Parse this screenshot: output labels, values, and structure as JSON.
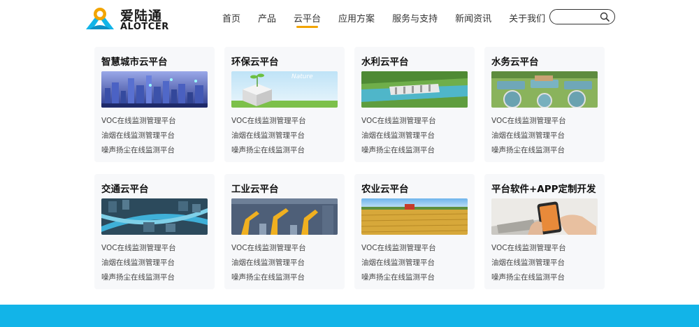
{
  "brand": {
    "name_cn": "爱陆通",
    "name_en": "ALOTCER"
  },
  "nav": [
    "首页",
    "产品",
    "云平台",
    "应用方案",
    "服务与支持",
    "新闻资讯",
    "关于我们"
  ],
  "nav_active": 2,
  "search": {
    "placeholder": ""
  },
  "colors": {
    "accent": "#f2a400",
    "footer": "#12b4e8",
    "card_bg": "#f7f8fa"
  },
  "cards": [
    {
      "title": "智慧城市云平台",
      "links": [
        "VOC在线监测管理平台",
        "油烟在线监测管理平台",
        "噪声扬尘在线监测平台"
      ],
      "img_label": ""
    },
    {
      "title": "环保云平台",
      "links": [
        "VOC在线监测管理平台",
        "油烟在线监测管理平台",
        "噪声扬尘在线监测平台"
      ],
      "img_label": "Nature"
    },
    {
      "title": "水利云平台",
      "links": [
        "VOC在线监测管理平台",
        "油烟在线监测管理平台",
        "噪声扬尘在线监测平台"
      ],
      "img_label": ""
    },
    {
      "title": "水务云平台",
      "links": [
        "VOC在线监测管理平台",
        "油烟在线监测管理平台",
        "噪声扬尘在线监测平台"
      ],
      "img_label": ""
    },
    {
      "title": "交通云平台",
      "links": [
        "VOC在线监测管理平台",
        "油烟在线监测管理平台",
        "噪声扬尘在线监测平台"
      ],
      "img_label": ""
    },
    {
      "title": "工业云平台",
      "links": [
        "VOC在线监测管理平台",
        "油烟在线监测管理平台",
        "噪声扬尘在线监测平台"
      ],
      "img_label": ""
    },
    {
      "title": "农业云平台",
      "links": [
        "VOC在线监测管理平台",
        "油烟在线监测管理平台",
        "噪声扬尘在线监测平台"
      ],
      "img_label": ""
    },
    {
      "title": "平台软件+APP定制开发",
      "links": [
        "VOC在线监测管理平台",
        "油烟在线监测管理平台",
        "噪声扬尘在线监测平台"
      ],
      "img_label": ""
    }
  ]
}
